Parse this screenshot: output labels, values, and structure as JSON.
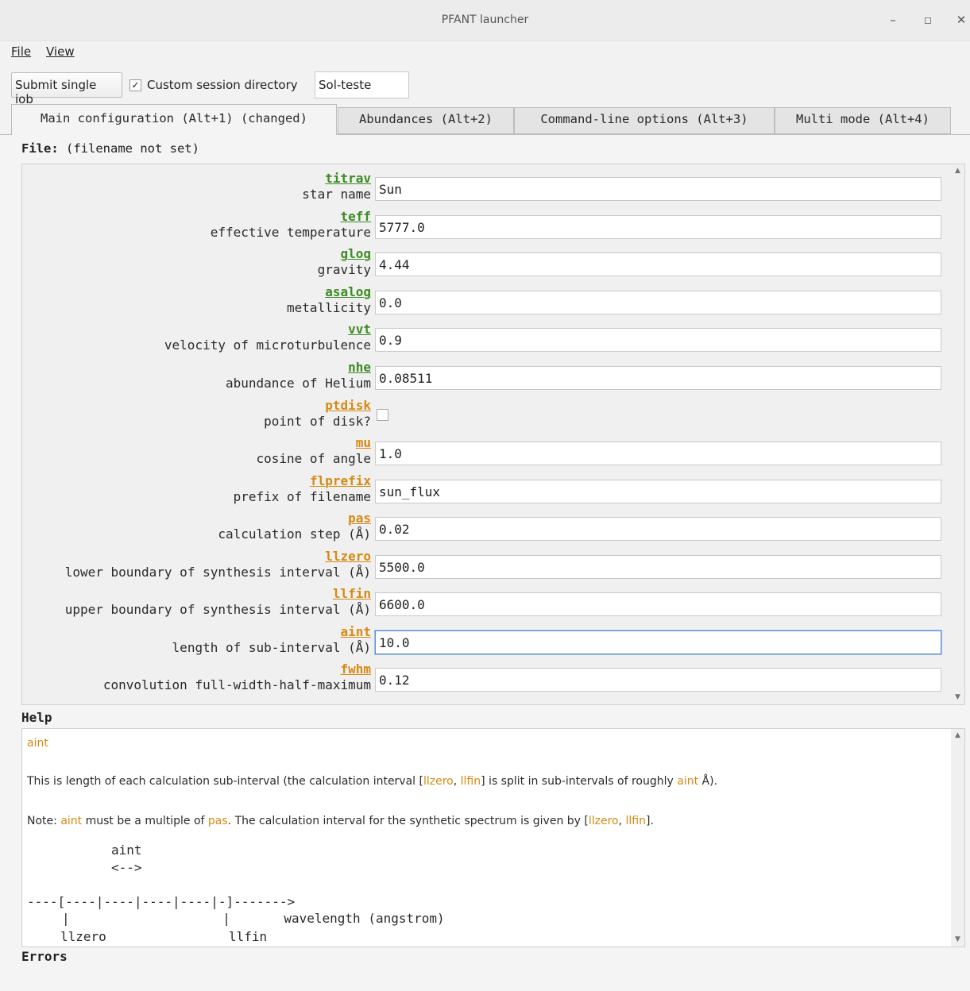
{
  "window": {
    "title": "PFANT launcher",
    "min": "–",
    "max": "◻",
    "close": "✕"
  },
  "menu": {
    "file": "File",
    "view": "View"
  },
  "toolbar": {
    "submit_label": "Submit single job",
    "custom_session_label": "Custom session directory",
    "custom_session_checked": true,
    "session_dir_value": "Sol-teste"
  },
  "tabs": [
    {
      "label": "Main configuration (Alt+1) (changed)",
      "active": true
    },
    {
      "label": "Abundances (Alt+2)",
      "active": false
    },
    {
      "label": "Command-line options (Alt+3)",
      "active": false
    },
    {
      "label": "Multi mode (Alt+4)",
      "active": false
    }
  ],
  "file_line": {
    "label": "File:",
    "value": "(filename not set)"
  },
  "params": [
    {
      "name": "titrav",
      "desc": "star name",
      "value": "Sun",
      "color": "green"
    },
    {
      "name": "teff",
      "desc": "effective temperature",
      "value": "5777.0",
      "color": "green"
    },
    {
      "name": "glog",
      "desc": "gravity",
      "value": "4.44",
      "color": "green"
    },
    {
      "name": "asalog",
      "desc": "metallicity",
      "value": "0.0",
      "color": "green"
    },
    {
      "name": "vvt",
      "desc": "velocity of microturbulence",
      "value": "0.9",
      "color": "green"
    },
    {
      "name": "nhe",
      "desc": "abundance of Helium",
      "value": "0.08511",
      "color": "green"
    },
    {
      "name": "ptdisk",
      "desc": "point of disk?",
      "value": "",
      "color": "orange"
    },
    {
      "name": "mu",
      "desc": "cosine of angle",
      "value": "1.0",
      "color": "orange"
    },
    {
      "name": "flprefix",
      "desc": "prefix of filename",
      "value": "sun_flux",
      "color": "orange"
    },
    {
      "name": "pas",
      "desc": "calculation step (Å)",
      "value": "0.02",
      "color": "orange"
    },
    {
      "name": "llzero",
      "desc": "lower boundary of synthesis interval (Å)",
      "value": "5500.0",
      "color": "orange"
    },
    {
      "name": "llfin",
      "desc": "upper boundary of synthesis interval (Å)",
      "value": "6600.0",
      "color": "orange"
    },
    {
      "name": "aint",
      "desc": "length of sub-interval (Å)",
      "value": "10.0",
      "color": "orange"
    },
    {
      "name": "fwhm",
      "desc": "convolution full-width-half-maximum",
      "value": "0.12",
      "color": "orange"
    }
  ],
  "colors": {
    "green": "#3d8b23",
    "orange": "#d68a12"
  },
  "help": {
    "heading": "Help",
    "keyword": "aint",
    "p1": {
      "t1": "This is length of each calculation sub-interval (the calculation interval [",
      "k1": "llzero",
      "t2": ", ",
      "k2": "llfin",
      "t3": "] is split in sub-intervals of roughly ",
      "k3": "aint",
      "t4": " Å)."
    },
    "p2": {
      "t1": "Note: ",
      "k1": "aint",
      "t2": " must be a multiple of ",
      "k2": "pas",
      "t3": ". The calculation interval for the synthetic spectrum is given by [",
      "k3": "llzero",
      "t4": ", ",
      "k4": "llfin",
      "t5": "]."
    },
    "diagram": {
      "line1": "aint",
      "line2": "<-->",
      "line3": "----[----|----|----|----|-]------->",
      "line4": "|                    |       wavelength (angstrom)",
      "line5": "llzero                llfin"
    }
  },
  "errors": {
    "heading": "Errors"
  }
}
